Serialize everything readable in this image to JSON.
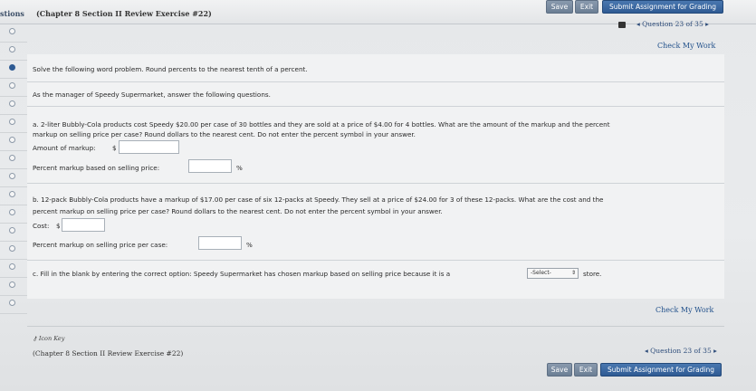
{
  "header": {
    "questions_label": "stions",
    "assignment_title": "(Chapter 8 Section II Review Exercise #22)",
    "save_label": "Save",
    "exit_label": "Exit",
    "submit_label": "Submit Assignment for Grading"
  },
  "nav": {
    "question_position": "Question 23 of 35",
    "check_work_label": "Check My Work"
  },
  "question": {
    "instruction": "Solve the following word problem. Round percents to the nearest tenth of a percent.",
    "intro": "As the manager of Speedy Supermarket, answer the following questions.",
    "part_a_line1": "a. 2-liter Bubbly-Cola products cost Speedy $20.00 per case of 30 bottles and they are sold at a price of $4.00 for 4 bottles. What are the amount of the markup and the percent",
    "part_a_line2": "markup on selling price per case? Round dollars to the nearest cent. Do not enter the percent symbol in your answer.",
    "part_a_amount_label": "Amount of markup:",
    "dollar_sign": "$",
    "part_a_percent_label": "Percent markup based on selling price:",
    "percent_sign": "%",
    "part_b_line1": "b. 12-pack Bubbly-Cola products have a markup of $17.00 per case of six 12-packs at Speedy. They sell at a price of $24.00 for 3 of these 12-packs. What are the cost and the",
    "part_b_line2": "percent markup on selling price per case? Round dollars to the nearest cent. Do not enter the percent symbol in your answer.",
    "part_b_cost_label": "Cost:",
    "part_b_percent_label": "Percent markup on selling price per case:",
    "part_c_text": "c. Fill in the blank by entering the correct option: Speedy Supermarket has chosen markup based on selling price because it is a",
    "part_c_select": "-Select-",
    "part_c_suffix": "store."
  },
  "footer": {
    "icon_key": "Icon Key",
    "assignment_title": "(Chapter 8 Section II Review Exercise #22)",
    "question_position": "Question 23 of 35",
    "save_label": "Save",
    "exit_label": "Exit",
    "submit_label": "Submit Assignment for Grading"
  },
  "colors": {
    "accent": "#2e5a93",
    "link": "#1f4f8a"
  }
}
